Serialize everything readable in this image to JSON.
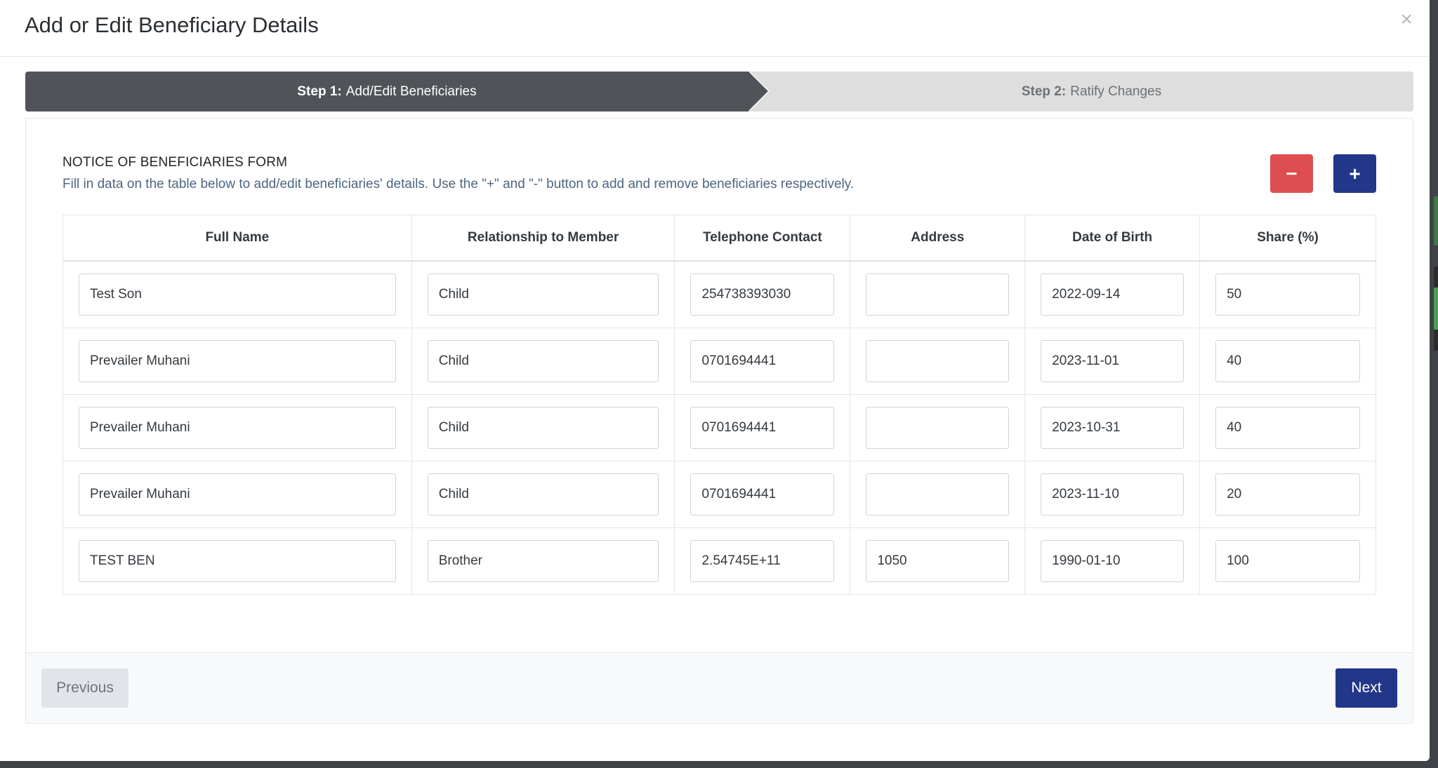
{
  "modal": {
    "title": "Add or Edit Beneficiary Details",
    "close_label": "×"
  },
  "steps": [
    {
      "prefix": "Step 1:",
      "label": "Add/Edit Beneficiaries",
      "active": true
    },
    {
      "prefix": "Step 2:",
      "label": "Ratify Changes",
      "active": false
    }
  ],
  "form": {
    "title": "NOTICE OF BENEFICIARIES FORM",
    "description": "Fill in data on the table below to add/edit beneficiaries' details. Use the \"+\" and \"-\" button to add and remove beneficiaries respectively.",
    "remove_label": "−",
    "add_label": "+"
  },
  "table": {
    "headers": [
      "Full Name",
      "Relationship to Member",
      "Telephone Contact",
      "Address",
      "Date of Birth",
      "Share (%)"
    ],
    "rows": [
      [
        "Test Son",
        "Child",
        "254738393030",
        "",
        "2022-09-14",
        "50"
      ],
      [
        "Prevailer Muhani",
        "Child",
        "0701694441",
        "",
        "2023-11-01",
        "40"
      ],
      [
        "Prevailer Muhani",
        "Child",
        "0701694441",
        "",
        "2023-10-31",
        "40"
      ],
      [
        "Prevailer Muhani",
        "Child",
        "0701694441",
        "",
        "2023-11-10",
        "20"
      ],
      [
        "TEST BEN",
        "Brother",
        "2.54745E+11",
        "1050",
        "1990-01-10",
        "100"
      ]
    ]
  },
  "footer": {
    "previous_label": "Previous",
    "next_label": "Next"
  },
  "colors": {
    "primary": "#22378a",
    "danger": "#de4d50",
    "step_active": "#505459"
  }
}
